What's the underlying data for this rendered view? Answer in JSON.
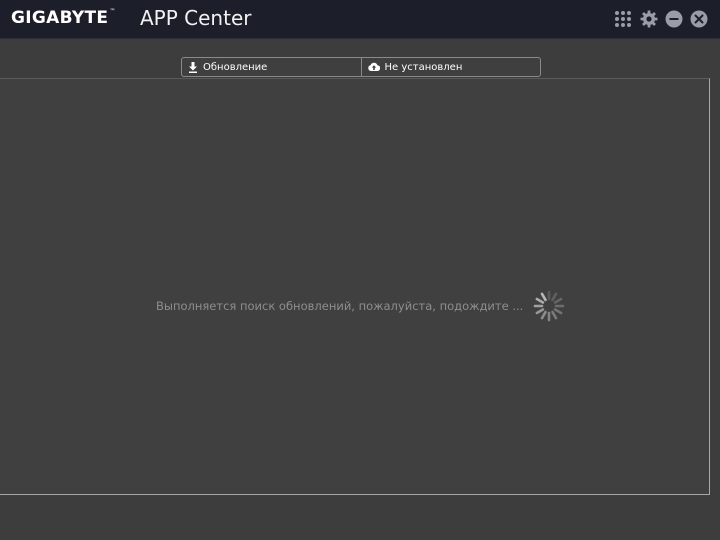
{
  "window": {
    "brand": "GIGABYTE",
    "brand_tm": "™",
    "title": "APP Center",
    "controls": [
      {
        "name": "apps-grid-icon"
      },
      {
        "name": "gear-icon"
      },
      {
        "name": "minimize-icon"
      },
      {
        "name": "close-icon"
      }
    ]
  },
  "tabs": [
    {
      "label": "Обновление",
      "icon": "download-icon"
    },
    {
      "label": "Не установлен",
      "icon": "cloud-upload-icon"
    }
  ],
  "main": {
    "status_text": "Выполняется поиск обновлений, пожалуйста, подождите ...",
    "spinner_icon": "loading-spinner-icon"
  },
  "colors": {
    "titlebar": "#1c1e29",
    "background": "#3d3d3d",
    "panel": "#404040",
    "status_text": "#8e8e8e"
  }
}
